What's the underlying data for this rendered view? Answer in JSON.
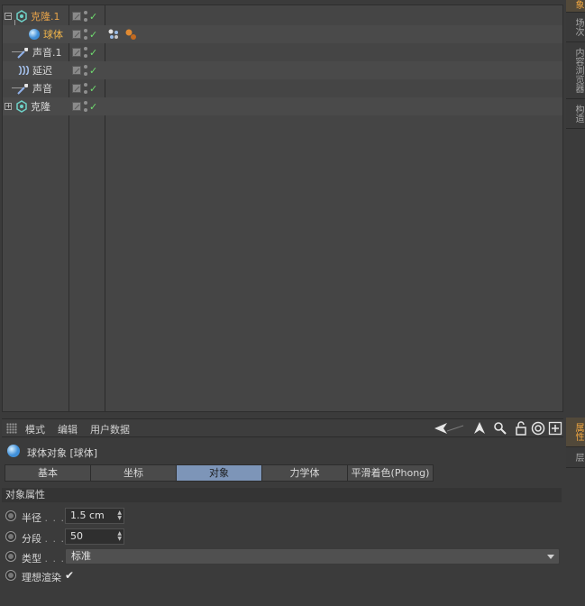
{
  "colors": {
    "accent_orange": "#f0a640",
    "active_tab": "#7d95b8",
    "check_green": "#6fdc6f"
  },
  "object_manager": {
    "objects": [
      {
        "name": "克隆.1",
        "icon": "cloner-icon",
        "tags": []
      },
      {
        "name": "球体",
        "icon": "sphere-icon",
        "tags": [
          "sphere-tag-icon",
          "material-tag-icon"
        ]
      },
      {
        "name": "声音.1",
        "icon": "sound-icon",
        "tags": []
      },
      {
        "name": "延迟",
        "icon": "delay-icon",
        "tags": []
      },
      {
        "name": "声音",
        "icon": "sound-icon",
        "tags": []
      },
      {
        "name": "克隆",
        "icon": "cloner-icon",
        "tags": []
      }
    ]
  },
  "side_tabs_top": [
    "象",
    "场次",
    "内容浏览器",
    "构造"
  ],
  "side_tabs_bottom": [
    "属性",
    "层"
  ],
  "attribute_manager": {
    "menu": [
      "模式",
      "编辑",
      "用户数据"
    ],
    "title": "球体对象 [球体]",
    "tabs": [
      "基本",
      "坐标",
      "对象",
      "力学体",
      "平滑着色(Phong)"
    ],
    "active_tab": "对象",
    "section_title": "对象属性",
    "props": {
      "radius_label": "半径",
      "radius_value": "1.5 cm",
      "segments_label": "分段",
      "segments_value": "50",
      "type_label": "类型",
      "type_value": "标准",
      "render_perfect_label": "理想渲染",
      "render_perfect_checked": "✔",
      "dots": ". . ."
    }
  }
}
